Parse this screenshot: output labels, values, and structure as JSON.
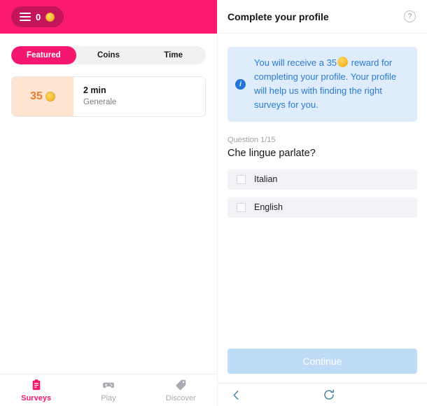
{
  "left_panel": {
    "header": {
      "menu_icon": "hamburger-icon",
      "coin_balance": "0",
      "coin_icon": "coin-icon"
    },
    "tabs": [
      {
        "label": "Featured",
        "active": true
      },
      {
        "label": "Coins",
        "active": false
      },
      {
        "label": "Time",
        "active": false
      }
    ],
    "surveys": [
      {
        "reward": "35",
        "reward_icon": "coin-icon",
        "duration": "2 min",
        "category": "Generale"
      }
    ],
    "bottom_nav": [
      {
        "label": "Surveys",
        "icon": "clipboard-icon",
        "active": true
      },
      {
        "label": "Play",
        "icon": "gamepad-icon",
        "active": false
      },
      {
        "label": "Discover",
        "icon": "tag-icon",
        "active": false
      }
    ]
  },
  "right_panel": {
    "header": {
      "title": "Complete your profile",
      "help_icon": "question-mark-circle-icon",
      "help_glyph": "?"
    },
    "info_box": {
      "icon": "info-circle-icon",
      "icon_glyph": "i",
      "text_before_coin": "You will receive a 35",
      "text_after_coin": "reward for completing your profile. Your profile will help us with finding the right surveys for you."
    },
    "survey": {
      "question_counter": "Question 1/15",
      "question": "Che lingue parlate?",
      "options": [
        {
          "label": "Italian",
          "checked": false
        },
        {
          "label": "English",
          "checked": false
        }
      ]
    },
    "continue_button": {
      "label": "Continue",
      "disabled": true
    },
    "browser_nav": {
      "back_icon": "chevron-left-icon",
      "reload_icon": "refresh-icon"
    }
  },
  "colors": {
    "brand_pink": "#fb1a6f",
    "pill_dark_pink": "#c4155b",
    "tab_active_pink": "#f5176f",
    "reward_bg": "#fde5d2",
    "reward_text": "#f07a2b",
    "info_bg": "#dfecfb",
    "info_text": "#2a7ad4",
    "info_icon": "#2176d8",
    "answer_row_bg": "#f1f3f6",
    "continue_bg": "#bedcf5",
    "nav_inactive": "#a9a9b2",
    "browser_nav_icon": "#4a82a0"
  }
}
